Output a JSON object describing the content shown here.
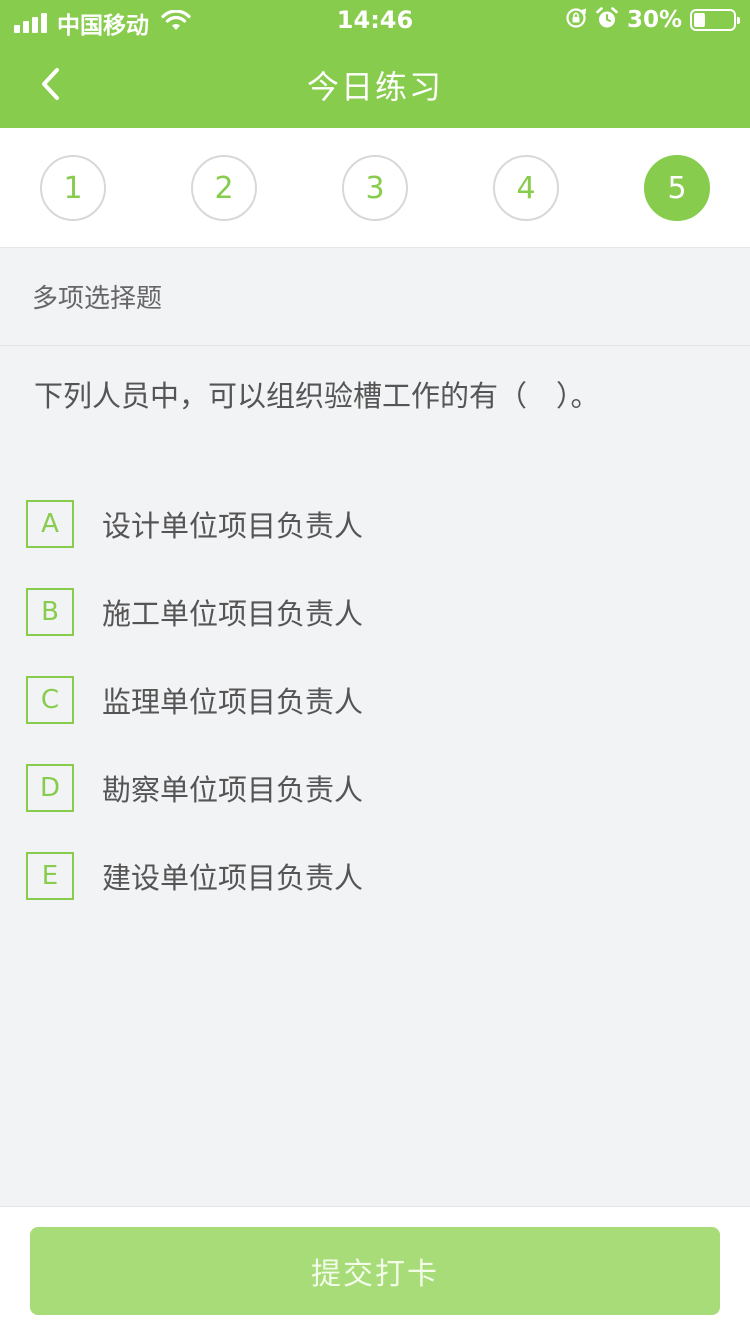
{
  "status_bar": {
    "carrier": "中国移动",
    "time": "14:46",
    "battery_percent": "30%",
    "battery_level": 0.3,
    "icons": [
      "signal-icon",
      "wifi-icon",
      "rotation-lock-icon",
      "alarm-icon",
      "battery-icon"
    ]
  },
  "nav": {
    "title": "今日练习",
    "back_icon": "chevron-left-icon"
  },
  "steps": {
    "items": [
      "1",
      "2",
      "3",
      "4",
      "5"
    ],
    "active": "5"
  },
  "question": {
    "type": "多项选择题",
    "text": "下列人员中，可以组织验槽工作的有（　）。",
    "options": [
      {
        "key": "A",
        "text": "设计单位项目负责人"
      },
      {
        "key": "B",
        "text": "施工单位项目负责人"
      },
      {
        "key": "C",
        "text": "监理单位项目负责人"
      },
      {
        "key": "D",
        "text": "勘察单位项目负责人"
      },
      {
        "key": "E",
        "text": "建设单位项目负责人"
      }
    ]
  },
  "footer": {
    "submit_label": "提交打卡"
  },
  "colors": {
    "accent": "#88cc4e",
    "submit_bg": "#a7dc78",
    "page_bg": "#f2f3f5"
  }
}
